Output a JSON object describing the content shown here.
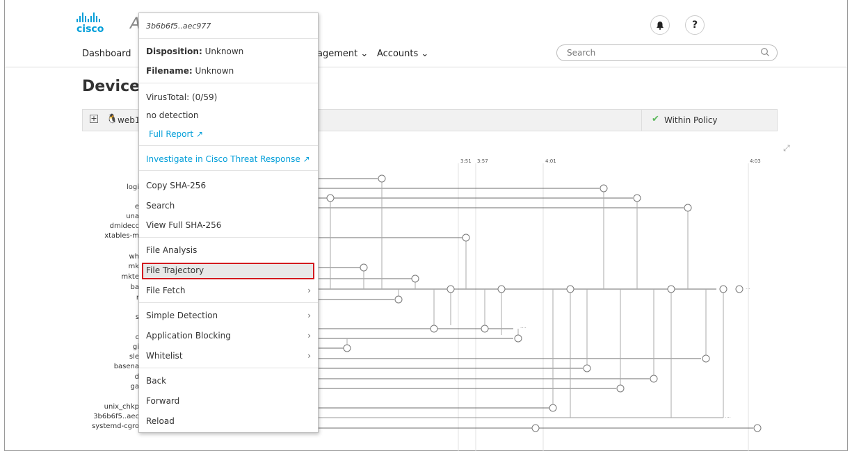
{
  "header": {
    "logo_text": "cisco",
    "app_initial": "A",
    "notifications_icon": "bell-icon",
    "help_label": "?",
    "nav": {
      "dashboard": "Dashboard",
      "management": "agement",
      "accounts": "Accounts"
    },
    "search_placeholder": "Search"
  },
  "page": {
    "title": "Device T",
    "device_host": "web1",
    "policy_status": "Within Policy"
  },
  "trajectory": {
    "time_labels": [
      "3:51",
      "3:57",
      "4:01",
      "4:03"
    ],
    "rows": [
      "logi",
      "e",
      "una",
      "dmidecc",
      "xtables-m",
      "wh",
      "mk",
      "mkte",
      "ba",
      "r",
      "s",
      "c",
      "gi",
      "sle",
      "basena",
      "d",
      "ga",
      "unix_chkp",
      "3b6b6f5..aec",
      "systemd-cgro"
    ]
  },
  "menu": {
    "hash": "3b6b6f5..aec977",
    "disposition_label": "Disposition:",
    "disposition_value": "Unknown",
    "filename_label": "Filename:",
    "filename_value": "Unknown",
    "virustotal": "VirusTotal: (0/59)",
    "detection": "no detection",
    "full_report": "Full Report",
    "investigate": "Investigate in Cisco Threat Response",
    "items": [
      "Copy SHA-256",
      "Search",
      "View Full SHA-256",
      "File Analysis",
      "File Trajectory",
      "File Fetch",
      "Simple Detection",
      "Application Blocking",
      "Whitelist",
      "Back",
      "Forward",
      "Reload"
    ],
    "highlighted_item": "File Trajectory",
    "highlight_color": "#d31a1f"
  },
  "colors": {
    "brand": "#049fd9",
    "policy_ok": "#5cb85c"
  }
}
